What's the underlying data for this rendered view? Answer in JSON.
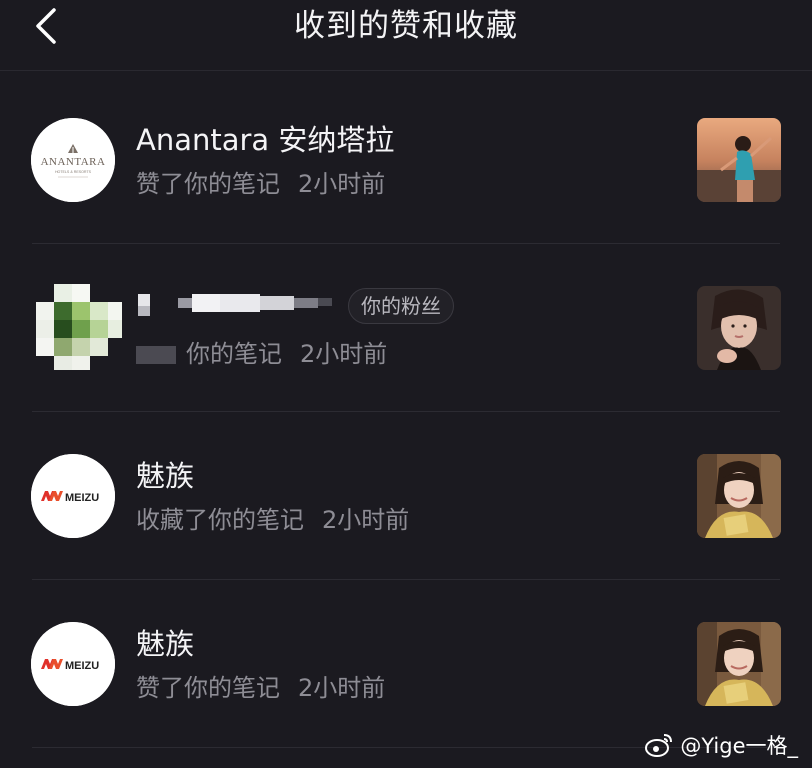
{
  "header": {
    "title": "收到的赞和收藏",
    "back_icon": "chevron-left-icon"
  },
  "items": [
    {
      "name": "Anantara 安纳塔拉",
      "action": "赞了你的笔记",
      "time": "2小时前",
      "avatar_logo": "ANANTARA",
      "avatar_sub": "HOTELS & RESORTS",
      "thumb": "woman-beach-photo"
    },
    {
      "name": "",
      "badge": "你的粉丝",
      "action": "你的笔记",
      "time": "2小时前",
      "avatar": "blurred-avatar",
      "thumb": "woman-selfie-photo"
    },
    {
      "name": "魅族",
      "action": "收藏了你的笔记",
      "time": "2小时前",
      "avatar_logo": "MEIZU",
      "thumb": "woman-gold-dress-photo"
    },
    {
      "name": "魅族",
      "action": "赞了你的笔记",
      "time": "2小时前",
      "avatar_logo": "MEIZU",
      "thumb": "woman-gold-dress-photo"
    }
  ],
  "watermark": {
    "text": "@Yige一格_",
    "icon": "weibo-icon"
  },
  "colors": {
    "background": "#1b1a20",
    "primary_text": "#f4f4f6",
    "secondary_text": "#8e8d95",
    "meizu_red": "#e0312b"
  }
}
